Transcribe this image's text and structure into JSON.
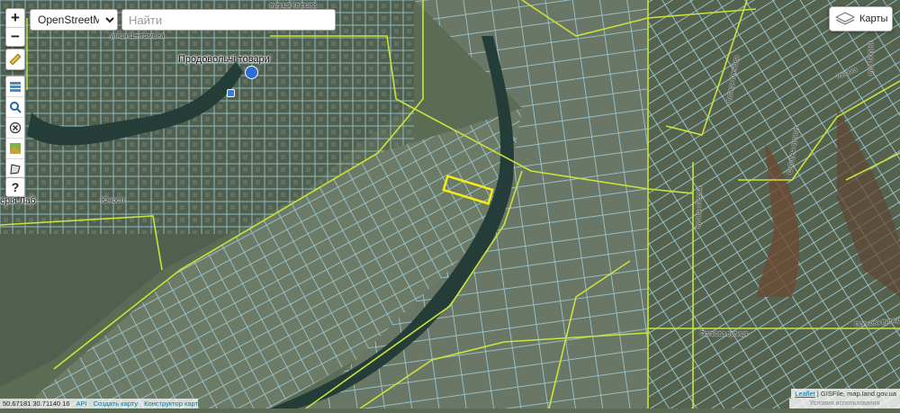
{
  "map": {
    "base_layer": "OpenStreetMap",
    "base_layer_options": [
      "OpenStreetMap"
    ],
    "colors": {
      "imagery": "#5b6b54",
      "parcel_outline": "#a9dbee",
      "boundary_line": "#c9e43a",
      "selected_parcel": "#f4ef0c",
      "river": "#253d38"
    }
  },
  "controls": {
    "zoom_in": "+",
    "zoom_out": "−",
    "tools": [
      "ruler-icon",
      "layers-stack-icon",
      "magnifier-icon",
      "clear-icon",
      "land-icon",
      "polygon-icon",
      "help-icon"
    ],
    "help_label": "?"
  },
  "search": {
    "placeholder": "Найти"
  },
  "layers_button": {
    "label": "Карты"
  },
  "labels": {
    "poi_shop": "Продовольчі товари",
    "street_left": "ерія Лаб",
    "street_yunosti": "Юності",
    "street_top": "улиця Центральна",
    "street_kvitkova": "вулиця Квіткова",
    "street_right_top": "ільська",
    "street_right_vert": "вул. Богуна",
    "street_bottom_mid": "Польова вулиця",
    "street_bottom_right": "Польова вулиця",
    "street_vert_1": "вулиця Кленова",
    "street_vert_2": "Соборна вулиця",
    "street_vert_3": "вулиця Лісова"
  },
  "footer": {
    "coords": "50.67181 30.71140 16",
    "api": "API",
    "create_map": "Создать карту",
    "constructor": "Конструктор карт"
  },
  "attribution": {
    "leaflet": "Leaflet",
    "separator": "|",
    "source": "GISFile, map.land.gov.ua",
    "terms": "Условия использования"
  }
}
